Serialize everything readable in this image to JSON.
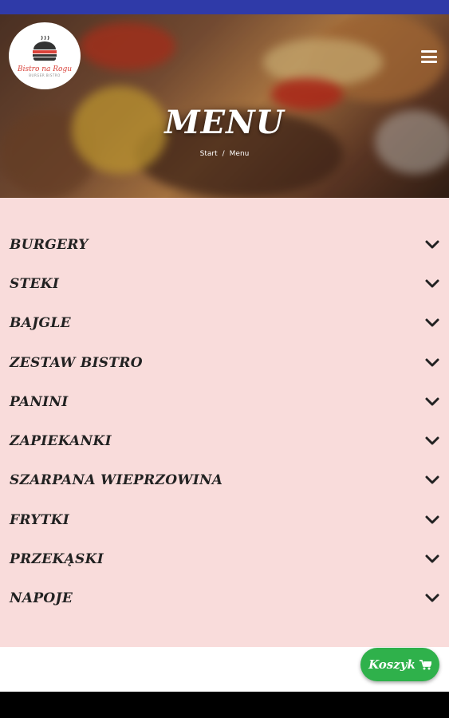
{
  "logo": {
    "name": "Bistro na Rogu",
    "sub": "BURGER BISTRO"
  },
  "header": {
    "title": "MENU",
    "breadcrumb": {
      "home": "Start",
      "separator": "/",
      "current": "Menu"
    }
  },
  "menu": {
    "items": [
      {
        "label": "BURGERY"
      },
      {
        "label": "STEKI"
      },
      {
        "label": "BAJGLE"
      },
      {
        "label": "ZESTAW BISTRO"
      },
      {
        "label": "PANINI"
      },
      {
        "label": "ZAPIEKANKI"
      },
      {
        "label": "SZARPANA WIEPRZOWINA"
      },
      {
        "label": "FRYTKI"
      },
      {
        "label": "PRZEKĄSKI"
      },
      {
        "label": "NAPOJE"
      }
    ]
  },
  "cart": {
    "label": "Koszyk",
    "icon": "cart-icon"
  },
  "colors": {
    "status_bar": "#2f3aa8",
    "menu_background": "#f9dcdb",
    "cart_button": "#2fb14b",
    "logo_accent": "#d9423a"
  },
  "icons": {
    "menu": "hamburger-icon",
    "expand": "chevron-down-icon",
    "logo": "burger-icon"
  }
}
